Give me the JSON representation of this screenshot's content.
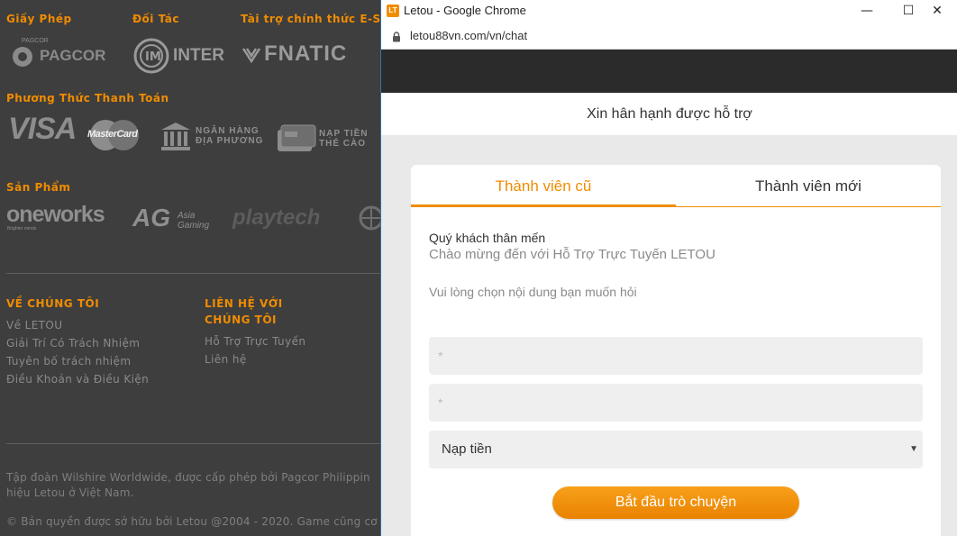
{
  "background": {
    "sections": {
      "license": "Giấy Phép",
      "partner": "Đối Tác",
      "sponsor": "Tài trợ chính thức E-Sp",
      "payment": "Phương Thức Thanh Toán",
      "products": "Sản Phẩm"
    },
    "logos": {
      "pagcor_small": "PAGCOR",
      "pagcor": "PAGCOR",
      "inter": "INTER",
      "fnatic": "FNATIC",
      "visa": "VISA",
      "mastercard": "MasterCard",
      "bank_line1": "NGÂN HÀNG",
      "bank_line2": "ĐỊA PHƯƠNG",
      "card_line1": "NẠP TIỀN",
      "card_line2": "THẺ CÀO",
      "oneworks": "oneworks",
      "oneworks_sub": "Brighter minds",
      "ag": "AG",
      "ag_line1": "Asia",
      "ag_line2": "Gaming",
      "playtech": "playtech"
    },
    "about_title": "VỀ CHÚNG TÔI",
    "about_links": [
      "Về LETOU",
      "Giải Trí Có Trách Nhiệm",
      "Tuyên bố trách nhiệm",
      "Điều Khoản và Điều Kiện"
    ],
    "contact_title_line1": "LIÊN HỆ VỚI",
    "contact_title_line2": "CHÚNG TÔI",
    "contact_links": [
      "Hỗ Trợ Trực Tuyến",
      "Liên hệ"
    ],
    "footer_line1": "Tập đoàn Wilshire Worldwide, được cấp phép bởi Pagcor Philippin",
    "footer_line2": "hiệu Letou ở Việt Nam.",
    "copyright": "© Bản quyền được sở hữu bởi Letou @2004 - 2020. Game cũng cơ"
  },
  "window": {
    "favicon": "LT",
    "title": "Letou - Google Chrome",
    "minimize": "—",
    "maximize": "☐",
    "close": "✕",
    "url": "letou88vn.com/vn/chat"
  },
  "chat": {
    "header": "Xin hân hạnh được hỗ trợ",
    "tabs": [
      "Thành viên cũ",
      "Thành viên mới"
    ],
    "greeting": "Quý khách thân mến",
    "welcome": "Chào mừng đến với Hỗ Trợ Trực Tuyến LETOU",
    "prompt": "Vui lòng chọn nội dung bạn muốn hỏi",
    "field1_placeholder": "*",
    "field2_placeholder": "*",
    "select_value": "Nạp tiền",
    "select_arrow": "▼",
    "start_button": "Bắt đầu trò chuyện"
  },
  "colors": {
    "accent": "#f08c00",
    "background": "#3e3e3e"
  }
}
